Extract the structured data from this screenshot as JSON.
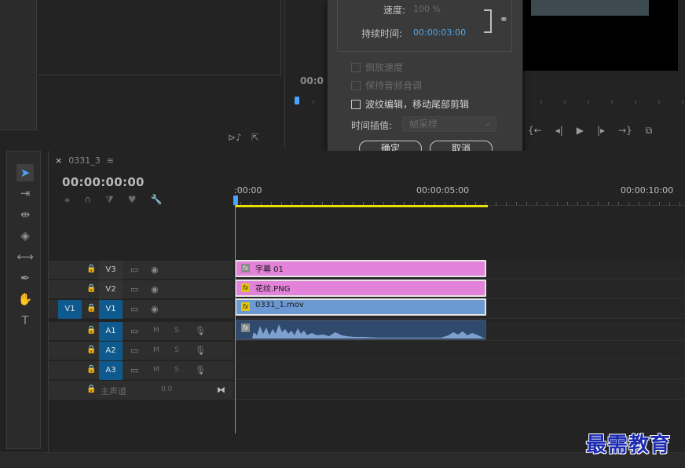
{
  "dialog": {
    "speed_label": "速度:",
    "speed_value": "100 %",
    "duration_label": "持续时间:",
    "duration_value": "00:00:03:00",
    "link_icon": "chain-link-icon",
    "reverse_speed": "倒放速度",
    "maintain_pitch": "保持音频音调",
    "ripple_edit": "波纹编辑，移动尾部剪辑",
    "interpolation_label": "时间插值:",
    "interpolation_value": "帧采样",
    "ok": "确定",
    "cancel": "取消"
  },
  "program_monitor": {
    "timecode": "00:0"
  },
  "timeline": {
    "sequence_name": "0331_3",
    "menu_icon": "≡",
    "timecode": "00:00:00:00",
    "ruler_labels": [
      ":00:00",
      "00:00:05:00",
      "00:00:10:00"
    ],
    "tracks": [
      {
        "name": "V3"
      },
      {
        "name": "V2"
      },
      {
        "name": "V1",
        "source": "V1"
      },
      {
        "name": "A1"
      },
      {
        "name": "A2"
      },
      {
        "name": "A3"
      }
    ],
    "master": {
      "label": "主声道",
      "value": "0.0"
    },
    "audio_toggles": {
      "mute": "M",
      "solo": "S"
    },
    "clips": [
      {
        "name": "字幕 01",
        "fx_color": "gray",
        "color": "#e283d9"
      },
      {
        "name": "花纹.PNG",
        "fx_color": "yellow",
        "color": "#e283d9"
      },
      {
        "name": "0331_1.mov",
        "fx_color": "yellow",
        "color": "#6d99d2"
      }
    ],
    "fx_label": "fx",
    "work_area_color": "#e8e100",
    "playhead_color": "#4aa3ff"
  },
  "tools": [
    "selection-tool",
    "track-select-tool",
    "ripple-edit-tool",
    "razor-tool",
    "slip-tool",
    "pen-tool",
    "hand-tool",
    "type-tool"
  ],
  "watermark": "最需教育"
}
